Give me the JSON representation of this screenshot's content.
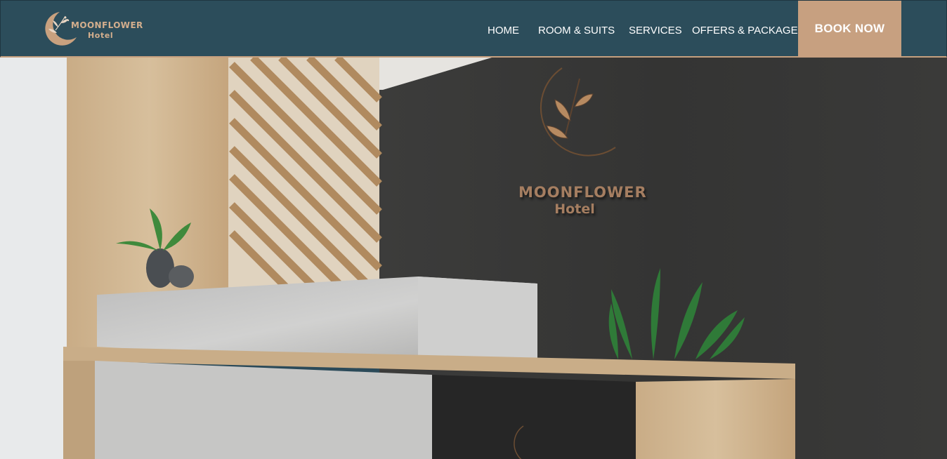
{
  "brand": {
    "name": "MOONFLOWER",
    "sub": "Hotel",
    "accent_color": "#c7a080",
    "header_color": "#2c4d5b"
  },
  "nav": {
    "items": [
      {
        "label": "HOME"
      },
      {
        "label": "ROOM & SUITS"
      },
      {
        "label": "SERVICES"
      },
      {
        "label": "OFFERS & PACKAGES"
      }
    ],
    "book_label": "BOOK NOW"
  },
  "hero": {
    "wall_sign_title": "MOONFLOWER",
    "wall_sign_sub": "Hotel",
    "icons": [
      "moon-flower-logo-icon",
      "plant-icon"
    ]
  }
}
